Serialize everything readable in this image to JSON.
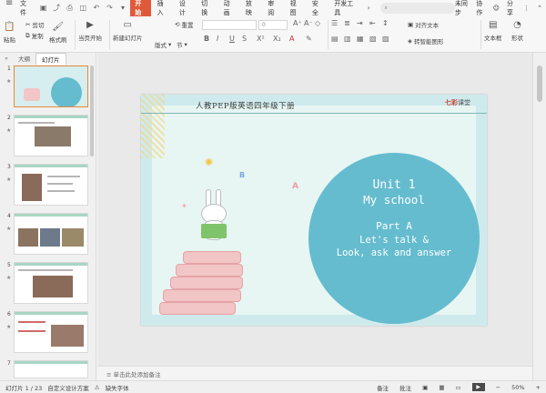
{
  "menubar": {
    "file": "文件",
    "tabs": [
      "开始",
      "插入",
      "设计",
      "切换",
      "动画",
      "放映",
      "审阅",
      "视图",
      "安全",
      "开发工具"
    ],
    "active_tab": "开始",
    "search_placeholder": "",
    "sync": "未同步",
    "collab": "协作",
    "share": "分享"
  },
  "ribbon": {
    "paste": "粘贴",
    "cut": "剪切",
    "copy": "复制",
    "format_painter": "格式刷",
    "slide_start": "当页开始",
    "new_slide": "新建幻灯片",
    "layout": "版式",
    "section": "节",
    "reset": "重置",
    "font_size": "0",
    "text_align": "对齐文本",
    "convert_smartart": "转智能图形",
    "textbox": "文本框",
    "shapes": "形状"
  },
  "left_panel": {
    "tab_outline": "大纲",
    "tab_slides": "幻灯片",
    "slides": [
      "1",
      "2",
      "3",
      "4",
      "5",
      "6",
      "7"
    ]
  },
  "slide": {
    "header": "人教PEP版英语四年级下册",
    "logo_red": "七彩",
    "logo_black": "课堂",
    "line1": "Unit 1",
    "line2": "My school",
    "line3": "Part A",
    "line4": "Let's talk &",
    "line5": "Look, ask and answer"
  },
  "notes": "单击此处添加备注",
  "status": {
    "slide_count": "幻灯片 1 / 23",
    "design": "自定义设计方案",
    "missing_font": "缺失字体",
    "notes": "备注",
    "comment": "批注",
    "zoom": "50%"
  }
}
